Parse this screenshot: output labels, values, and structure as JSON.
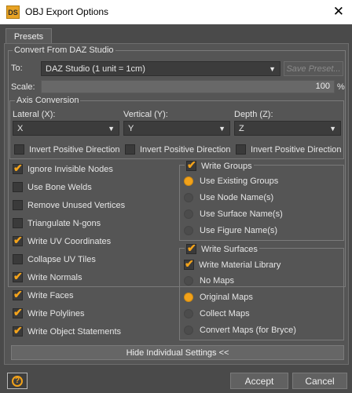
{
  "window": {
    "icon_text": "DS",
    "title": "OBJ Export Options",
    "close_glyph": "✕"
  },
  "tabs": [
    {
      "label": "Presets"
    }
  ],
  "convert": {
    "group_label": "Convert From DAZ Studio",
    "to_label": "To:",
    "to_value": "DAZ Studio (1 unit = 1cm)",
    "save_preset_label": "Save Preset...",
    "scale_label": "Scale:",
    "scale_value": "100",
    "scale_unit": "%"
  },
  "axis": {
    "group_label": "Axis Conversion",
    "lateral": {
      "label": "Lateral (X):",
      "value": "X",
      "invert_label": "Invert Positive Direction",
      "invert_checked": false
    },
    "vertical": {
      "label": "Vertical (Y):",
      "value": "Y",
      "invert_label": "Invert Positive Direction",
      "invert_checked": false
    },
    "depth": {
      "label": "Depth (Z):",
      "value": "Z",
      "invert_label": "Invert Positive Direction",
      "invert_checked": false
    }
  },
  "options": [
    {
      "label": "Ignore Invisible Nodes",
      "checked": true
    },
    {
      "label": "Use Bone Welds",
      "checked": false
    },
    {
      "label": "Remove Unused Vertices",
      "checked": false
    },
    {
      "label": "Triangulate N-gons",
      "checked": false
    },
    {
      "label": "Write UV Coordinates",
      "checked": true
    },
    {
      "label": "Collapse UV Tiles",
      "checked": false
    },
    {
      "label": "Write Normals",
      "checked": true
    },
    {
      "label": "Write Faces",
      "checked": true
    },
    {
      "label": "Write Polylines",
      "checked": true
    },
    {
      "label": "Write Object Statements",
      "checked": true
    }
  ],
  "write_groups": {
    "label": "Write Groups",
    "checked": true,
    "radios": [
      {
        "label": "Use Existing Groups",
        "selected": true
      },
      {
        "label": "Use Node Name(s)",
        "selected": false
      },
      {
        "label": "Use Surface Name(s)",
        "selected": false
      },
      {
        "label": "Use Figure Name(s)",
        "selected": false
      }
    ]
  },
  "write_surfaces": {
    "label": "Write Surfaces",
    "checked": true,
    "material_library_label": "Write Material Library",
    "material_library_checked": true,
    "radios": [
      {
        "label": "No Maps",
        "selected": false
      },
      {
        "label": "Original Maps",
        "selected": true
      },
      {
        "label": "Collect Maps",
        "selected": false
      },
      {
        "label": "Convert Maps (for Bryce)",
        "selected": false
      }
    ]
  },
  "hide_settings_label": "Hide Individual Settings <<",
  "footer": {
    "help_glyph": "?",
    "accept_label": "Accept",
    "cancel_label": "Cancel"
  },
  "colors": {
    "accent": "#f2a21a",
    "panel_bg": "#555555",
    "window_bg": "#4a4a4a"
  }
}
